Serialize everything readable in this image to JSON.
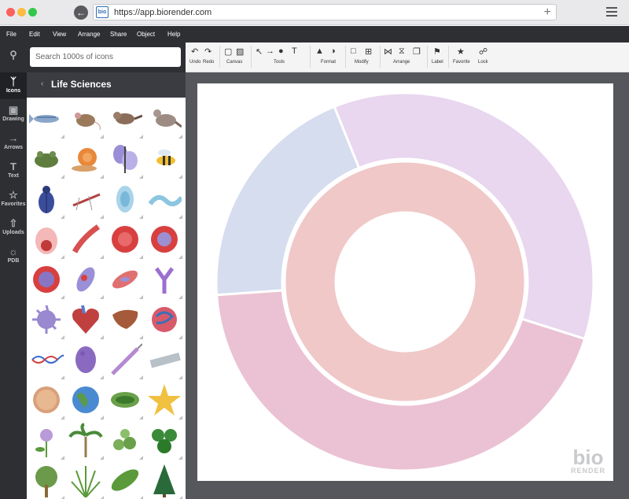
{
  "browser": {
    "url": "https://app.biorender.com",
    "logo_text": "bio",
    "back_icon": "arrow-left-icon",
    "new_tab_icon": "plus-icon",
    "menu_icon": "hamburger-icon"
  },
  "menubar": {
    "items": [
      "File",
      "Edit",
      "View",
      "Arrange",
      "Share",
      "Object",
      "Help"
    ]
  },
  "rail": {
    "items": [
      {
        "label": "",
        "icon": "search-icon"
      },
      {
        "label": "Icons",
        "icon": "icons-icon"
      },
      {
        "label": "Drawing",
        "icon": "drawing-icon"
      },
      {
        "label": "Arrows",
        "icon": "arrows-icon"
      },
      {
        "label": "Text",
        "icon": "text-icon"
      },
      {
        "label": "Favorites",
        "icon": "star-icon"
      },
      {
        "label": "Uploads",
        "icon": "upload-icon"
      },
      {
        "label": "PDB",
        "icon": "pdb-icon"
      }
    ]
  },
  "panel": {
    "search_placeholder": "Search 1000s of icons",
    "category_title": "Life Sciences",
    "icons": [
      "zebrafish-icon",
      "mouse-icon",
      "sparrow-icon",
      "dove-icon",
      "frog-icon",
      "snail-icon",
      "butterfly-icon",
      "wasp-icon",
      "beetle-icon",
      "mosquito-icon",
      "protist-icon",
      "worm-icon",
      "egg-cell-icon",
      "red-worm-icon",
      "red-blood-cell-icon",
      "blood-cell-icon",
      "cell-nucleus-icon",
      "sperm-cell-icon",
      "muscle-cell-icon",
      "antibody-icon",
      "macrophage-icon",
      "heart-icon",
      "liver-icon",
      "intestine-icon",
      "dna-icon",
      "tumor-icon",
      "syringe-icon",
      "slide-icon",
      "petri-dish-icon",
      "globe-icon",
      "chloroplast-icon",
      "starfish-icon",
      "flower-icon",
      "palm-icon",
      "herb-icon",
      "clover-icon",
      "tree-icon",
      "grass-icon",
      "leaf-icon",
      "pine-icon"
    ]
  },
  "toolbar": {
    "groups": [
      {
        "label": "Undo",
        "icon": "undo-icon"
      },
      {
        "label": "Redo",
        "icon": "redo-icon"
      },
      {
        "label": "Canvas",
        "icon": "canvas-icon"
      },
      {
        "label": "Tools",
        "icon": "tools-icon"
      },
      {
        "label": "Format",
        "icon": "format-icon"
      },
      {
        "label": "Modify",
        "icon": "modify-icon"
      },
      {
        "label": "Arrange",
        "icon": "arrange-icon"
      },
      {
        "label": "Label",
        "icon": "label-icon"
      },
      {
        "label": "Favorite",
        "icon": "star-icon"
      },
      {
        "label": "Lock",
        "icon": "lock-icon"
      }
    ]
  },
  "canvas": {
    "watermark_line1": "bio",
    "watermark_line2": "RENDER"
  },
  "chart_data": {
    "type": "pie",
    "title": "",
    "rings": [
      {
        "name": "",
        "values": [
          36,
          44,
          20
        ],
        "colors": [
          "#e9d6ef",
          "#ebc2d3",
          "#d5ddef"
        ]
      },
      {
        "name": "",
        "values": [
          100
        ],
        "colors": [
          "#f0c8c8"
        ]
      }
    ]
  }
}
